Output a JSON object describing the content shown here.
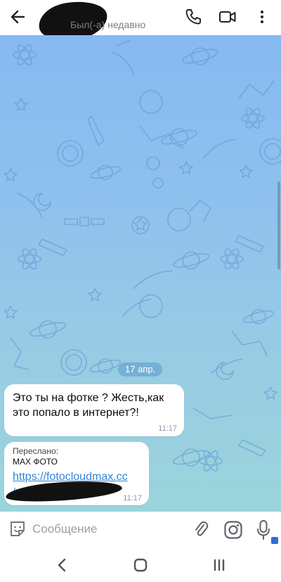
{
  "header": {
    "status": "Был(-а) недавно",
    "icons": [
      "back-arrow-icon",
      "phone-icon",
      "video-camera-icon",
      "more-vertical-icon"
    ]
  },
  "chat": {
    "date_separator": "17 апр.",
    "messages": [
      {
        "text": "Это ты на фотке ? Жесть,как это попало в интернет?!",
        "time": "11:17"
      },
      {
        "forwarded_label": "Переслано:",
        "forwarded_from": "MAX ФОТО",
        "link": "https://fotocloudmax.cc",
        "link_cut": "/",
        "time": "11:17"
      }
    ]
  },
  "composer": {
    "placeholder": "Сообщение",
    "icons": [
      "sticker-icon",
      "paperclip-icon",
      "instagram-camera-icon",
      "microphone-icon"
    ]
  },
  "navigation": {
    "icons": [
      "nav-back-icon",
      "nav-home-icon",
      "nav-recent-apps-icon"
    ]
  },
  "colors": {
    "link": "#2f86d6",
    "bubble": "#ffffff",
    "date_pill": "#6eaad2",
    "chat_top": "#86b9f0",
    "chat_bottom": "#9bd4db"
  }
}
